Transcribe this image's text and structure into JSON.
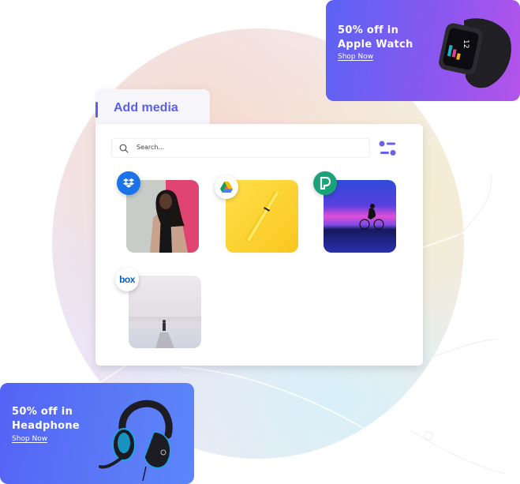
{
  "media_picker": {
    "tab_title": "Add media",
    "search": {
      "placeholder": "Search...",
      "value": ""
    },
    "filter_icon": "sliders-icon",
    "items": [
      {
        "source": "Dropbox",
        "icon": "dropbox-icon",
        "subject": "Woman in beige coat",
        "badge_color": "#1a73e8"
      },
      {
        "source": "Google Drive",
        "icon": "google-drive-icon",
        "subject": "Yellow pen",
        "badge_color": "#ffffff"
      },
      {
        "source": "Pexels",
        "icon": "pexels-icon",
        "subject": "Cyclist at sunset",
        "badge_color": "#1aa37a"
      },
      {
        "source": "Box",
        "icon": "box-icon",
        "subject": "Person on pier",
        "badge_color": "#ffffff",
        "badge_text": "box"
      }
    ]
  },
  "promos": [
    {
      "title_line1": "50% off in",
      "title_line2": "Apple Watch",
      "link": "Shop Now",
      "product": "smartwatch-image"
    },
    {
      "title_line1": "50% off in",
      "title_line2": "Headphone",
      "link": "Shop Now",
      "product": "headphone-image"
    }
  ],
  "colors": {
    "accent": "#5b5fe6",
    "watch_card_gradient": [
      "#5b63f4",
      "#b553ea"
    ],
    "headphone_card_gradient": [
      "#5463f6",
      "#5c86fa"
    ]
  }
}
